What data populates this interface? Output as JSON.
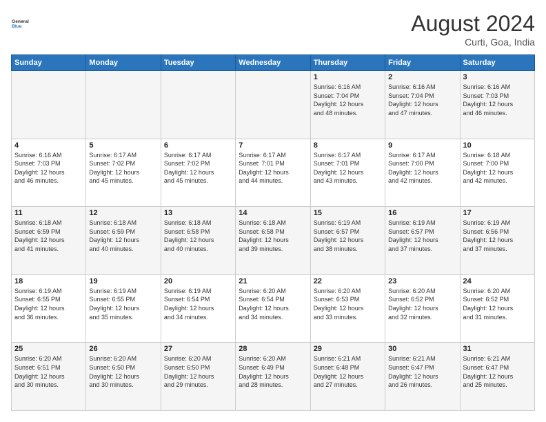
{
  "header": {
    "logo_line1": "General",
    "logo_line2": "Blue",
    "title": "August 2024",
    "subtitle": "Curti, Goa, India"
  },
  "days_of_week": [
    "Sunday",
    "Monday",
    "Tuesday",
    "Wednesday",
    "Thursday",
    "Friday",
    "Saturday"
  ],
  "weeks": [
    [
      {
        "day": "",
        "info": ""
      },
      {
        "day": "",
        "info": ""
      },
      {
        "day": "",
        "info": ""
      },
      {
        "day": "",
        "info": ""
      },
      {
        "day": "1",
        "info": "Sunrise: 6:16 AM\nSunset: 7:04 PM\nDaylight: 12 hours\nand 48 minutes."
      },
      {
        "day": "2",
        "info": "Sunrise: 6:16 AM\nSunset: 7:04 PM\nDaylight: 12 hours\nand 47 minutes."
      },
      {
        "day": "3",
        "info": "Sunrise: 6:16 AM\nSunset: 7:03 PM\nDaylight: 12 hours\nand 46 minutes."
      }
    ],
    [
      {
        "day": "4",
        "info": "Sunrise: 6:16 AM\nSunset: 7:03 PM\nDaylight: 12 hours\nand 46 minutes."
      },
      {
        "day": "5",
        "info": "Sunrise: 6:17 AM\nSunset: 7:02 PM\nDaylight: 12 hours\nand 45 minutes."
      },
      {
        "day": "6",
        "info": "Sunrise: 6:17 AM\nSunset: 7:02 PM\nDaylight: 12 hours\nand 45 minutes."
      },
      {
        "day": "7",
        "info": "Sunrise: 6:17 AM\nSunset: 7:01 PM\nDaylight: 12 hours\nand 44 minutes."
      },
      {
        "day": "8",
        "info": "Sunrise: 6:17 AM\nSunset: 7:01 PM\nDaylight: 12 hours\nand 43 minutes."
      },
      {
        "day": "9",
        "info": "Sunrise: 6:17 AM\nSunset: 7:00 PM\nDaylight: 12 hours\nand 42 minutes."
      },
      {
        "day": "10",
        "info": "Sunrise: 6:18 AM\nSunset: 7:00 PM\nDaylight: 12 hours\nand 42 minutes."
      }
    ],
    [
      {
        "day": "11",
        "info": "Sunrise: 6:18 AM\nSunset: 6:59 PM\nDaylight: 12 hours\nand 41 minutes."
      },
      {
        "day": "12",
        "info": "Sunrise: 6:18 AM\nSunset: 6:59 PM\nDaylight: 12 hours\nand 40 minutes."
      },
      {
        "day": "13",
        "info": "Sunrise: 6:18 AM\nSunset: 6:58 PM\nDaylight: 12 hours\nand 40 minutes."
      },
      {
        "day": "14",
        "info": "Sunrise: 6:18 AM\nSunset: 6:58 PM\nDaylight: 12 hours\nand 39 minutes."
      },
      {
        "day": "15",
        "info": "Sunrise: 6:19 AM\nSunset: 6:57 PM\nDaylight: 12 hours\nand 38 minutes."
      },
      {
        "day": "16",
        "info": "Sunrise: 6:19 AM\nSunset: 6:57 PM\nDaylight: 12 hours\nand 37 minutes."
      },
      {
        "day": "17",
        "info": "Sunrise: 6:19 AM\nSunset: 6:56 PM\nDaylight: 12 hours\nand 37 minutes."
      }
    ],
    [
      {
        "day": "18",
        "info": "Sunrise: 6:19 AM\nSunset: 6:55 PM\nDaylight: 12 hours\nand 36 minutes."
      },
      {
        "day": "19",
        "info": "Sunrise: 6:19 AM\nSunset: 6:55 PM\nDaylight: 12 hours\nand 35 minutes."
      },
      {
        "day": "20",
        "info": "Sunrise: 6:19 AM\nSunset: 6:54 PM\nDaylight: 12 hours\nand 34 minutes."
      },
      {
        "day": "21",
        "info": "Sunrise: 6:20 AM\nSunset: 6:54 PM\nDaylight: 12 hours\nand 34 minutes."
      },
      {
        "day": "22",
        "info": "Sunrise: 6:20 AM\nSunset: 6:53 PM\nDaylight: 12 hours\nand 33 minutes."
      },
      {
        "day": "23",
        "info": "Sunrise: 6:20 AM\nSunset: 6:52 PM\nDaylight: 12 hours\nand 32 minutes."
      },
      {
        "day": "24",
        "info": "Sunrise: 6:20 AM\nSunset: 6:52 PM\nDaylight: 12 hours\nand 31 minutes."
      }
    ],
    [
      {
        "day": "25",
        "info": "Sunrise: 6:20 AM\nSunset: 6:51 PM\nDaylight: 12 hours\nand 30 minutes."
      },
      {
        "day": "26",
        "info": "Sunrise: 6:20 AM\nSunset: 6:50 PM\nDaylight: 12 hours\nand 30 minutes."
      },
      {
        "day": "27",
        "info": "Sunrise: 6:20 AM\nSunset: 6:50 PM\nDaylight: 12 hours\nand 29 minutes."
      },
      {
        "day": "28",
        "info": "Sunrise: 6:20 AM\nSunset: 6:49 PM\nDaylight: 12 hours\nand 28 minutes."
      },
      {
        "day": "29",
        "info": "Sunrise: 6:21 AM\nSunset: 6:48 PM\nDaylight: 12 hours\nand 27 minutes."
      },
      {
        "day": "30",
        "info": "Sunrise: 6:21 AM\nSunset: 6:47 PM\nDaylight: 12 hours\nand 26 minutes."
      },
      {
        "day": "31",
        "info": "Sunrise: 6:21 AM\nSunset: 6:47 PM\nDaylight: 12 hours\nand 25 minutes."
      }
    ]
  ]
}
